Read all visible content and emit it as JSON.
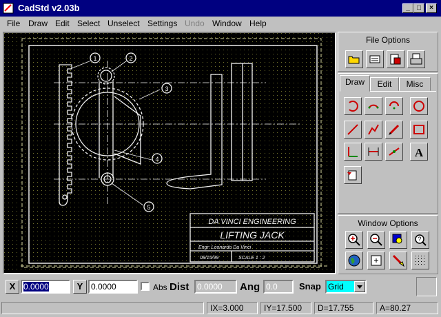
{
  "window": {
    "title": "CadStd v2.03b",
    "minimize": "_",
    "maximize": "□",
    "close": "×"
  },
  "menu": [
    "File",
    "Draw",
    "Edit",
    "Select",
    "Unselect",
    "Settings",
    "Undo",
    "Window",
    "Help"
  ],
  "drawing": {
    "company": "DA  VINCI  ENGINEERING",
    "title": "LIFTING  JACK",
    "engineer": "Engr: Leonardo Da Vinci",
    "date": "08/15/99",
    "scale": "SCALE  1 : 2",
    "callouts": [
      "1",
      "2",
      "3",
      "4",
      "5"
    ]
  },
  "file_options": {
    "title": "File Options"
  },
  "tabs": [
    "Draw",
    "Edit",
    "Misc"
  ],
  "window_options": {
    "title": "Window Options"
  },
  "coords": {
    "x_label": "X",
    "x_value": "0.0000",
    "y_label": "Y",
    "y_value": "0.0000",
    "abs_label": "Abs",
    "dist_label": "Dist",
    "dist_value": "0.0000",
    "ang_label": "Ang",
    "ang_value": "0.0",
    "snap_label": "Snap",
    "snap_value": "Grid"
  },
  "status": {
    "ix": "IX=3.000",
    "iy": "IY=17.500",
    "d": "D=17.755",
    "a": "A=80.27"
  }
}
